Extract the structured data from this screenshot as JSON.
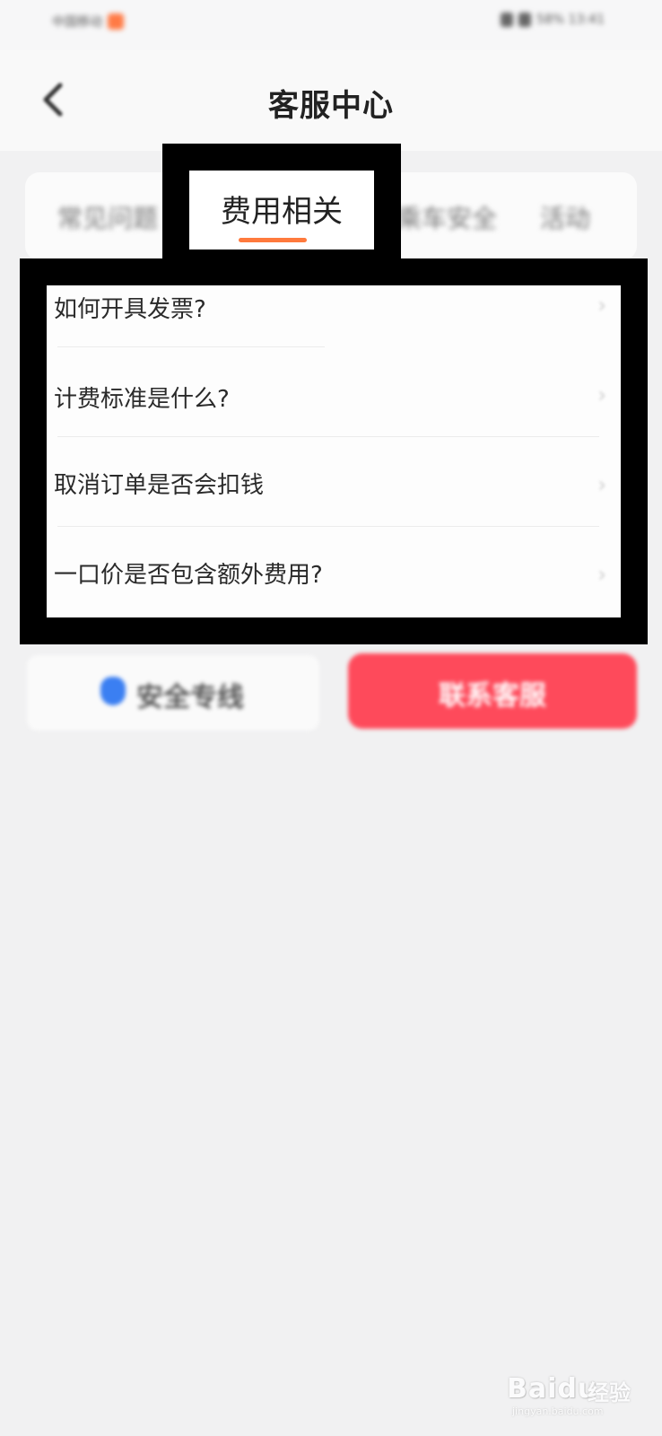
{
  "status_bar": {
    "left_text": "中国移动",
    "right_text": "58% 13:41"
  },
  "header": {
    "title": "客服中心",
    "back_icon": "chevron-left-icon"
  },
  "tabs": [
    {
      "label": "常见问题",
      "active": false
    },
    {
      "label": "费用相关",
      "active": true
    },
    {
      "label": "乘车安全",
      "active": false
    },
    {
      "label": "活动",
      "active": false
    }
  ],
  "faq": [
    {
      "question": "如何开具发票?"
    },
    {
      "question": "计费标准是什么?"
    },
    {
      "question": "取消订单是否会扣钱"
    },
    {
      "question": "一口价是否包含额外费用?"
    }
  ],
  "actions": {
    "safety_label": "安全专线",
    "contact_label": "联系客服"
  },
  "watermark": {
    "brand": "Bai",
    "brand2": "du",
    "cn": "经验",
    "url": "jingyan.baidu.com"
  },
  "colors": {
    "accent_orange": "#ff7a3d",
    "primary_red": "#fe4a5b",
    "shield_blue": "#3b7ff2",
    "page_bg": "#f1f1f2"
  }
}
